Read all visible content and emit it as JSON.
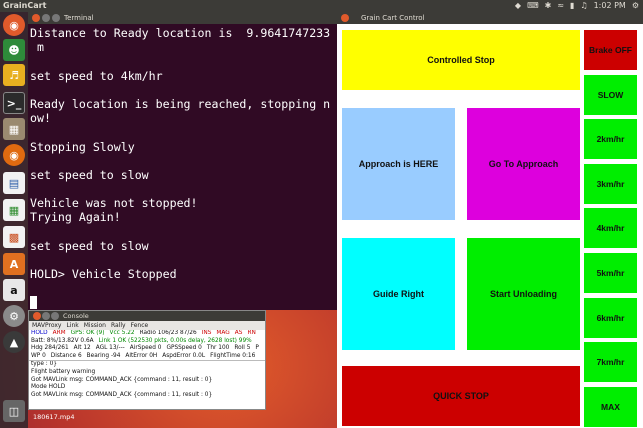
{
  "topbar": {
    "app_name": "GrainCart",
    "time": "1:02 PM",
    "icons": [
      "dropbox-icon",
      "keyboard-icon",
      "bluetooth-icon",
      "wifi-icon",
      "battery-icon",
      "volume-icon",
      "gear-icon"
    ]
  },
  "launcher": {
    "icons": [
      "ubuntu-search-icon",
      "chat-app-icon",
      "wine-app-icon",
      "terminal-icon",
      "files-icon",
      "firefox-icon",
      "writer-icon",
      "calc-icon",
      "impress-icon",
      "software-center-icon",
      "amazon-icon",
      "settings-icon",
      "update-icon",
      "trash-icon"
    ]
  },
  "terminal": {
    "title": "Terminal",
    "lines": [
      "Distance to Ready location is  9.9641747233",
      " m",
      "",
      "set speed to 4km/hr",
      "",
      "Ready location is being reached, stopping n",
      "ow!",
      "",
      "Stopping Slowly",
      "",
      "set speed to slow",
      "",
      "Vehicle was not stopped!",
      "Trying Again!",
      "",
      "set speed to slow",
      "",
      "HOLD> Vehicle Stopped",
      "",
      ""
    ]
  },
  "console": {
    "title": "Console",
    "menu": [
      "MAVProxy",
      "Link",
      "Mission",
      "Rally",
      "Fence"
    ],
    "status_rows": [
      [
        {
          "text": "HOLD",
          "color": "#0000cc"
        },
        {
          "text": "ARM",
          "color": "#cc0000"
        },
        {
          "text": "GPS: OK (9)",
          "color": "#008800"
        },
        {
          "text": "Vcc 5.22",
          "color": "#008800"
        },
        {
          "text": "Radio 106/23 87/26",
          "color": "#111111"
        },
        {
          "text": "INS",
          "color": "#cc0000"
        },
        {
          "text": "MAG",
          "color": "#cc0000"
        },
        {
          "text": "AS",
          "color": "#cc0000"
        },
        {
          "text": "RN",
          "color": "#cc0000"
        }
      ],
      [
        {
          "text": "Batt: 8%/13.82V 0.6A",
          "color": "#111111"
        },
        {
          "text": "Link 1 OK (522530 pkts, 0.00s delay, 2628 lost) 99%",
          "color": "#008800"
        }
      ],
      [
        {
          "text": "Hdg 284/261",
          "color": "#111111"
        },
        {
          "text": "Alt 12",
          "color": "#111111"
        },
        {
          "text": "AGL 13/---",
          "color": "#111111"
        },
        {
          "text": "AirSpeed 0",
          "color": "#111111"
        },
        {
          "text": "GPSSpeed 0",
          "color": "#111111"
        },
        {
          "text": "Thr 100",
          "color": "#111111"
        },
        {
          "text": "Roll 5",
          "color": "#111111"
        },
        {
          "text": "P",
          "color": "#111111"
        }
      ],
      [
        {
          "text": "WP 0",
          "color": "#111111"
        },
        {
          "text": "Distance 6",
          "color": "#111111"
        },
        {
          "text": "Bearing -94",
          "color": "#111111"
        },
        {
          "text": "AltError 0H",
          "color": "#111111"
        },
        {
          "text": "AspdError 0.0L",
          "color": "#111111"
        },
        {
          "text": "FlightTime 0:16",
          "color": "#111111"
        }
      ]
    ],
    "log_lines": [
      "type : 0}",
      "Flight battery warning",
      "Got MAVLink msg: COMMAND_ACK {command : 11, result : 0}",
      "Mode HOLD",
      "Got MAVLink msg: COMMAND_ACK {command : 11, result : 0}"
    ]
  },
  "desktop": {
    "file_label": "180617.mp4"
  },
  "grain_cart": {
    "title": "Grain Cart Control",
    "buttons": {
      "controlled_stop": {
        "label": "Controlled Stop",
        "color": "#ffff00"
      },
      "approach_here": {
        "label": "Approach is HERE",
        "color": "#99ccff"
      },
      "go_to_approach": {
        "label": "Go To Approach",
        "color": "#dd00dd"
      },
      "guide_right": {
        "label": "Guide Right",
        "color": "#00ffff"
      },
      "start_unloading": {
        "label": "Start Unloading",
        "color": "#00ee00"
      },
      "quick_stop": {
        "label": "QUICK STOP",
        "color": "#cc0000"
      }
    },
    "side": [
      {
        "label": "Brake OFF",
        "color": "#cc0000"
      },
      {
        "label": "SLOW",
        "color": "#00ee00"
      },
      {
        "label": "2km/hr",
        "color": "#00ee00"
      },
      {
        "label": "3km/hr",
        "color": "#00ee00"
      },
      {
        "label": "4km/hr",
        "color": "#00ee00"
      },
      {
        "label": "5km/hr",
        "color": "#00ee00"
      },
      {
        "label": "6km/hr",
        "color": "#00ee00"
      },
      {
        "label": "7km/hr",
        "color": "#00ee00"
      },
      {
        "label": "MAX",
        "color": "#00ee00"
      }
    ]
  }
}
